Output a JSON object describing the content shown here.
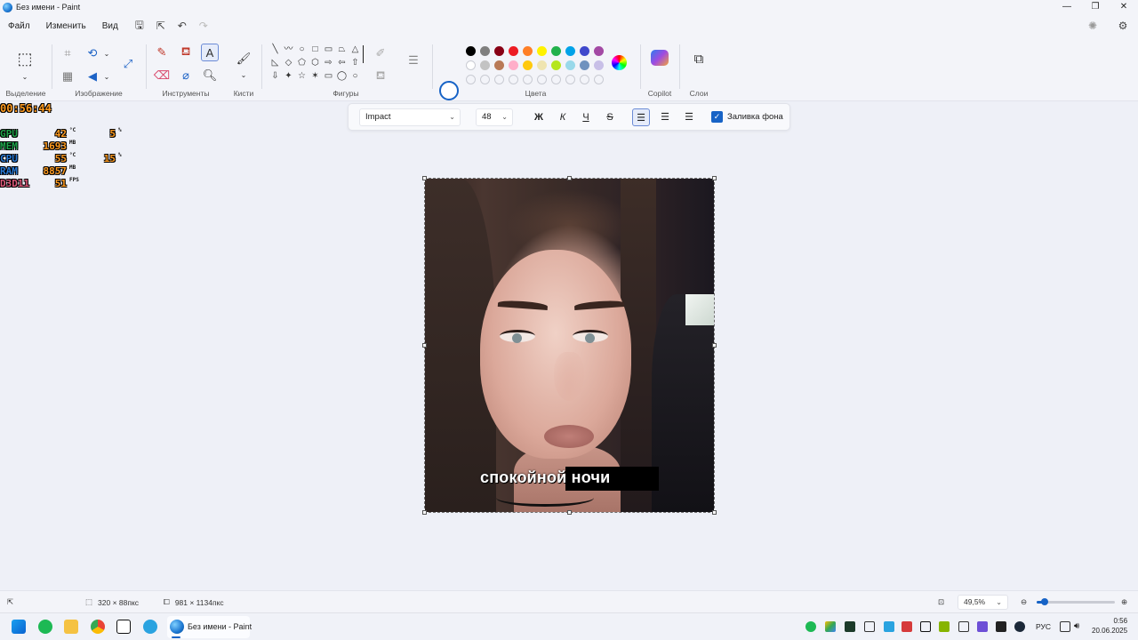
{
  "window": {
    "title": "Без имени - Paint",
    "controls": {
      "minimize": "—",
      "maximize": "❐",
      "close": "✕"
    }
  },
  "menu": {
    "items": [
      "Файл",
      "Изменить",
      "Вид"
    ]
  },
  "ribbon": {
    "groups": {
      "selection": "Выделение",
      "image": "Изображение",
      "tools": "Инструменты",
      "brushes": "Кисти",
      "shapes": "Фигуры",
      "colors": "Цвета",
      "copilot": "Copilot",
      "layers": "Слои"
    },
    "shape_glyphs": [
      "╲",
      "〰",
      "○",
      "□",
      "▭",
      "⏢",
      "△",
      "◺",
      "◇",
      "⬠",
      "⬡",
      "⇨",
      "⇦",
      "⇧",
      "⇩",
      "✦",
      "☆",
      "✶",
      "▭",
      "◯",
      "○"
    ],
    "palette_row1": [
      "#000000",
      "#7f7f7f",
      "#880015",
      "#ed1c24",
      "#ff7f27",
      "#fff200",
      "#22b14c",
      "#00a2e8",
      "#3f48cc",
      "#a349a4"
    ],
    "palette_row2": [
      "#ffffff",
      "#c3c3c3",
      "#b97a57",
      "#ffaec9",
      "#ffc90e",
      "#efe4b0",
      "#b5e61d",
      "#99d9ea",
      "#7092be",
      "#c8bfe7"
    ],
    "primary_color": "#ffffff",
    "secondary_color": "#000000"
  },
  "text_toolbar": {
    "font": "Impact",
    "size": "48",
    "bold": "Ж",
    "italic": "К",
    "underline": "Ч",
    "strike": "S",
    "fill_background_label": "Заливка фона",
    "fill_background_checked": true
  },
  "canvas": {
    "caption_text": "спокойной ночи"
  },
  "osd": {
    "time": "00:56:44",
    "rows": [
      {
        "label": "GPU",
        "label_color": "#1fa24a",
        "value": "42",
        "unit": "°C",
        "value2": "5",
        "unit2": "%"
      },
      {
        "label": "MEM",
        "label_color": "#1fa24a",
        "value": "1693",
        "unit": "MB",
        "value2": "",
        "unit2": ""
      },
      {
        "label": "CPU",
        "label_color": "#2a7bd8",
        "value": "55",
        "unit": "°C",
        "value2": "15",
        "unit2": "%"
      },
      {
        "label": "RAM",
        "label_color": "#2a7bd8",
        "value": "8857",
        "unit": "MB",
        "value2": "",
        "unit2": ""
      },
      {
        "label": "D3D11",
        "label_color": "#e05a7a",
        "value": "51",
        "unit": "FPS",
        "value2": "",
        "unit2": ""
      }
    ]
  },
  "statusbar": {
    "selection_size": "320 × 88пкс",
    "image_size": "981 × 1134пкс",
    "zoom": "49,5%",
    "zoom_fraction": 0.1
  },
  "taskbar": {
    "active_app": "Без имени - Paint",
    "language": "РУС",
    "time": "0:56",
    "date": "20.06.2025"
  }
}
